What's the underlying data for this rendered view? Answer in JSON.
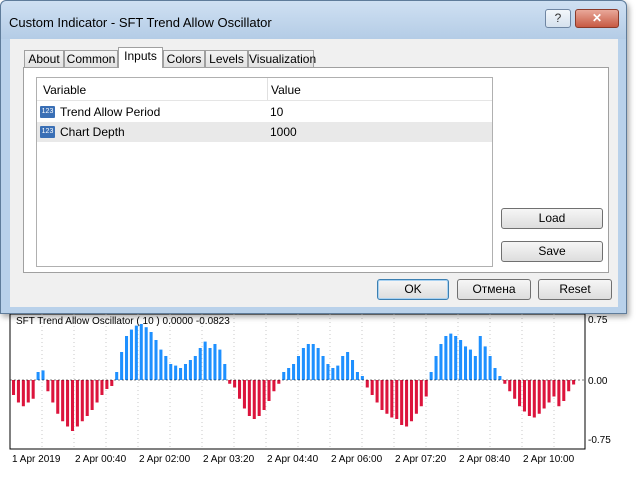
{
  "dialog": {
    "title": "Custom Indicator - SFT Trend Allow Oscillator",
    "help_glyph": "?",
    "close_glyph": "✕",
    "tabs": [
      "About",
      "Common",
      "Inputs",
      "Colors",
      "Levels",
      "Visualization"
    ],
    "active_tab": "Inputs",
    "grid": {
      "headers": [
        "Variable",
        "Value"
      ],
      "rows": [
        {
          "icon": "123",
          "variable": "Trend Allow Period",
          "value": "10"
        },
        {
          "icon": "123",
          "variable": "Chart Depth",
          "value": "1000"
        }
      ]
    },
    "load_label": "Load",
    "save_label": "Save",
    "ok_label": "OK",
    "cancel_label": "Отмена",
    "reset_label": "Reset"
  },
  "chart": {
    "label": "SFT Trend Allow Oscillator ( 10 ) 0.0000 -0.0823"
  },
  "chart_data": {
    "type": "bar",
    "title": "SFT Trend Allow Oscillator ( 10 ) 0.0000 -0.0823",
    "y_ticks": [
      "0.75",
      "0.00",
      "-0.75"
    ],
    "ylim": [
      -0.8,
      0.75
    ],
    "x_tick_labels": [
      "1 Apr 2019",
      "2 Apr 00:40",
      "2 Apr 02:00",
      "2 Apr 03:20",
      "2 Apr 04:40",
      "2 Apr 06:00",
      "2 Apr 07:20",
      "2 Apr 08:40",
      "2 Apr 10:00"
    ],
    "series": [
      {
        "color": "#1e90ff",
        "sign": "positive"
      },
      {
        "color": "#dc143c",
        "sign": "negative"
      }
    ],
    "values": [
      -0.2,
      -0.3,
      -0.35,
      -0.3,
      -0.25,
      0.1,
      0.12,
      -0.15,
      -0.3,
      -0.45,
      -0.55,
      -0.62,
      -0.68,
      -0.62,
      -0.55,
      -0.48,
      -0.4,
      -0.3,
      -0.2,
      -0.12,
      -0.08,
      0.1,
      0.35,
      0.55,
      0.63,
      0.68,
      0.7,
      0.66,
      0.6,
      0.5,
      0.38,
      0.3,
      0.2,
      0.18,
      0.15,
      0.2,
      0.25,
      0.3,
      0.4,
      0.48,
      0.4,
      0.45,
      0.38,
      0.2,
      -0.05,
      -0.1,
      -0.25,
      -0.38,
      -0.48,
      -0.52,
      -0.48,
      -0.4,
      -0.28,
      -0.15,
      -0.05,
      0.1,
      0.15,
      0.2,
      0.3,
      0.4,
      0.45,
      0.45,
      0.4,
      0.3,
      0.2,
      0.15,
      0.18,
      0.3,
      0.35,
      0.25,
      0.1,
      0.05,
      -0.1,
      -0.2,
      -0.3,
      -0.4,
      -0.45,
      -0.5,
      -0.52,
      -0.6,
      -0.62,
      -0.55,
      -0.45,
      -0.35,
      -0.22,
      0.1,
      0.3,
      0.45,
      0.55,
      0.58,
      0.55,
      0.5,
      0.42,
      0.38,
      0.3,
      0.55,
      0.42,
      0.3,
      0.15,
      0.05,
      -0.05,
      -0.15,
      -0.25,
      -0.35,
      -0.42,
      -0.48,
      -0.5,
      -0.45,
      -0.38,
      -0.3,
      -0.22,
      -0.35,
      -0.28,
      -0.15,
      -0.06
    ],
    "grid": true
  }
}
